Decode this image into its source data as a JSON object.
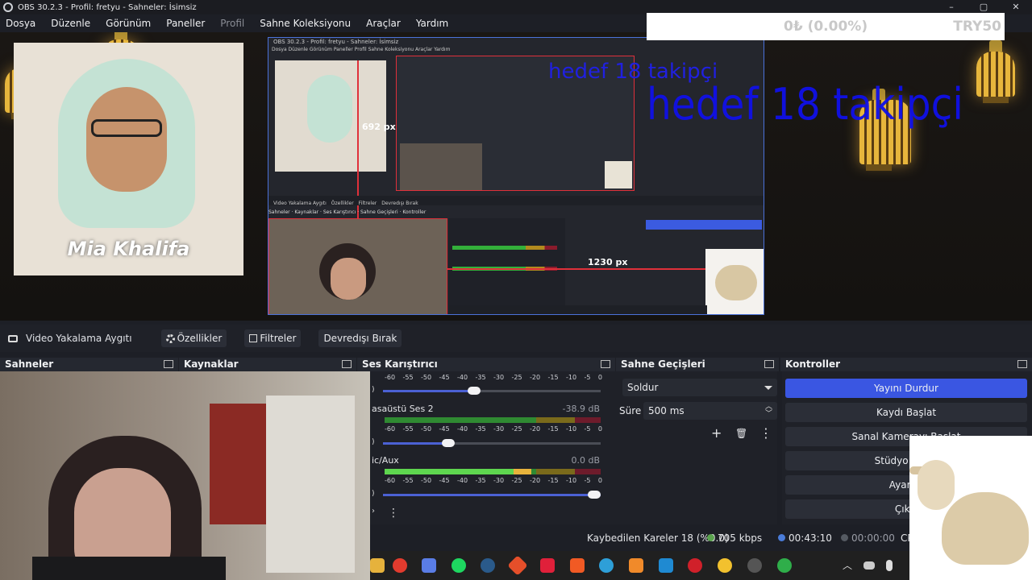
{
  "window": {
    "title": "OBS 30.2.3 - Profil: fretyu - Sahneler: İsimsiz",
    "minimize": "–",
    "maximize": "▢",
    "close": "✕"
  },
  "menu": [
    "Dosya",
    "Düzenle",
    "Görünüm",
    "Paneller",
    "Profil",
    "Sahne Koleksiyonu",
    "Araçlar",
    "Yardım"
  ],
  "preview": {
    "left_card_name": "Mia Khalifa",
    "overlay_text": "hedef 18 takipçi",
    "donation_amount": "0₺ (0.00%)",
    "donation_goal": "TRY50",
    "nested_width_label": "692 px",
    "nested_height_label": "1230 px",
    "nested_title": "OBS 30.2.3 - Profil: fretyu - Sahneler: İsimsiz"
  },
  "source_toolbar": {
    "source_name": "Video Yakalama Aygıtı",
    "properties": "Özellikler",
    "filters": "Filtreler",
    "disable": "Devredışı Bırak"
  },
  "docks": {
    "scenes": "Sahneler",
    "sources": "Kaynaklar",
    "mixer": "Ses Karıştırıcı",
    "transitions": "Sahne Geçişleri",
    "controls": "Kontroller"
  },
  "mixer": {
    "ticks": [
      "-60",
      "-55",
      "-50",
      "-45",
      "-40",
      "-35",
      "-30",
      "-25",
      "-20",
      "-15",
      "-10",
      "-5",
      "0"
    ],
    "channels": [
      {
        "name": "",
        "db": "",
        "level": 0.0,
        "volume": 0.42
      },
      {
        "name": "asaüstü Ses 2",
        "db": "-38.9 dB",
        "level": 0.0,
        "volume": 0.3
      },
      {
        "name": "ic/Aux",
        "db": "0.0 dB",
        "level": 0.68,
        "volume": 1.0
      }
    ],
    "menu_icon": "⋮"
  },
  "transitions": {
    "selected": "Soldur",
    "duration_label": "Süre",
    "duration_value": "500 ms",
    "add_icon": "+",
    "delete_icon": "🗑",
    "more_icon": "⋮"
  },
  "controls": {
    "buttons": [
      "Yayını Durdur",
      "Kaydı Başlat",
      "Sanal Kamerayı Başlat",
      "Stüdyo Modu",
      "Ayarlar",
      "Çıkış"
    ]
  },
  "status": {
    "dropped": "Kaybedilen Kareler 18 (%0.0)",
    "bitrate": "705 kbps",
    "live_time": "00:43:10",
    "rec_time": "00:00:00",
    "cpu": "CPU"
  },
  "colors": {
    "accent": "#3a56e2",
    "overlay_text": "#1010e8",
    "meter_green": "#5ed64f",
    "meter_yellow": "#7a6a1b",
    "meter_red": "#6d1b2b"
  }
}
